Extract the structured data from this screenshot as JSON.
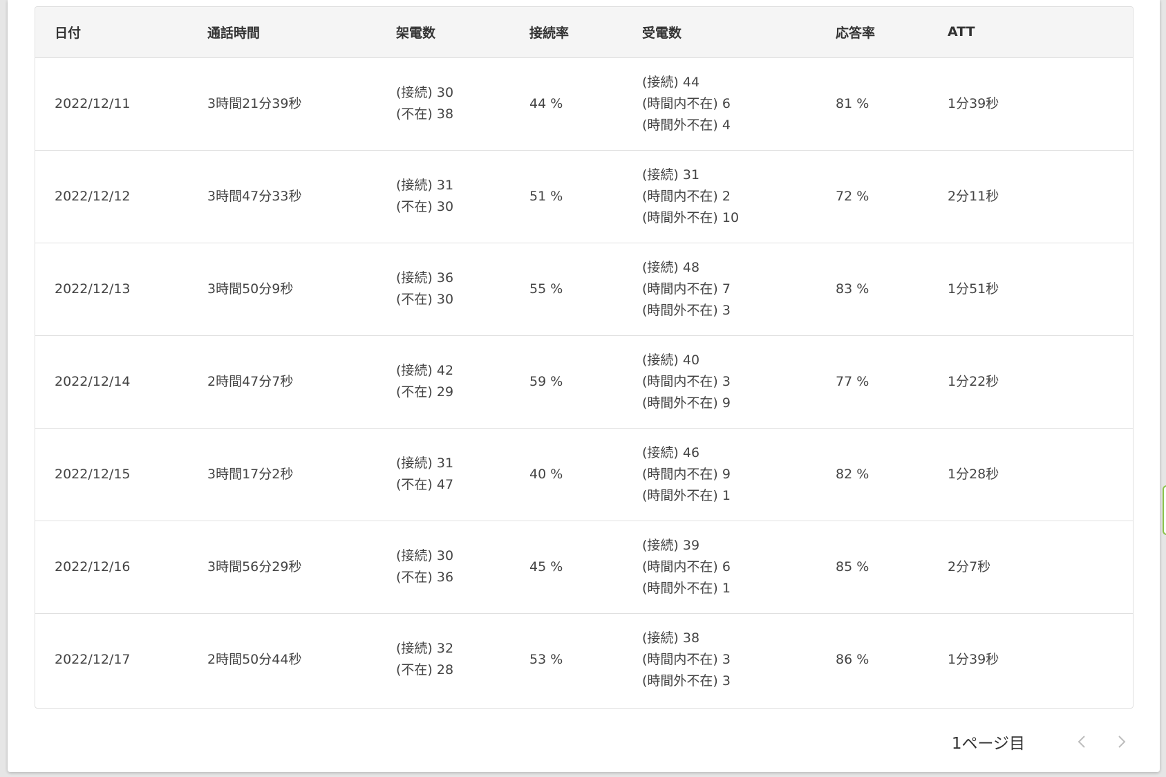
{
  "table": {
    "headers": [
      "日付",
      "通話時間",
      "架電数",
      "接続率",
      "受電数",
      "応答率",
      "ATT"
    ],
    "rows": [
      {
        "date": "2022/12/11",
        "talk_time": "3時間21分39秒",
        "outbound": [
          "(接続) 30",
          "(不在) 38"
        ],
        "connect_rate": "44 %",
        "inbound": [
          "(接続) 44",
          "(時間内不在) 6",
          "(時間外不在) 4"
        ],
        "answer_rate": "81 %",
        "att": "1分39秒"
      },
      {
        "date": "2022/12/12",
        "talk_time": "3時間47分33秒",
        "outbound": [
          "(接続) 31",
          "(不在) 30"
        ],
        "connect_rate": "51 %",
        "inbound": [
          "(接続) 31",
          "(時間内不在) 2",
          "(時間外不在) 10"
        ],
        "answer_rate": "72 %",
        "att": "2分11秒"
      },
      {
        "date": "2022/12/13",
        "talk_time": "3時間50分9秒",
        "outbound": [
          "(接続) 36",
          "(不在) 30"
        ],
        "connect_rate": "55 %",
        "inbound": [
          "(接続) 48",
          "(時間内不在) 7",
          "(時間外不在) 3"
        ],
        "answer_rate": "83 %",
        "att": "1分51秒"
      },
      {
        "date": "2022/12/14",
        "talk_time": "2時間47分7秒",
        "outbound": [
          "(接続) 42",
          "(不在) 29"
        ],
        "connect_rate": "59 %",
        "inbound": [
          "(接続) 40",
          "(時間内不在) 3",
          "(時間外不在) 9"
        ],
        "answer_rate": "77 %",
        "att": "1分22秒"
      },
      {
        "date": "2022/12/15",
        "talk_time": "3時間17分2秒",
        "outbound": [
          "(接続) 31",
          "(不在) 47"
        ],
        "connect_rate": "40 %",
        "inbound": [
          "(接続) 46",
          "(時間内不在) 9",
          "(時間外不在) 1"
        ],
        "answer_rate": "82 %",
        "att": "1分28秒"
      },
      {
        "date": "2022/12/16",
        "talk_time": "3時間56分29秒",
        "outbound": [
          "(接続) 30",
          "(不在) 36"
        ],
        "connect_rate": "45 %",
        "inbound": [
          "(接続) 39",
          "(時間内不在) 6",
          "(時間外不在) 1"
        ],
        "answer_rate": "85 %",
        "att": "2分7秒"
      },
      {
        "date": "2022/12/17",
        "talk_time": "2時間50分44秒",
        "outbound": [
          "(接続) 32",
          "(不在) 28"
        ],
        "connect_rate": "53 %",
        "inbound": [
          "(接続) 38",
          "(時間内不在) 3",
          "(時間外不在) 3"
        ],
        "answer_rate": "86 %",
        "att": "1分39秒"
      }
    ]
  },
  "pagination": {
    "page_label": "1ページ目",
    "prev_icon": "chevron-left-icon",
    "next_icon": "chevron-right-icon"
  },
  "colors": {
    "header_bg": "#f5f5f5",
    "border": "#e0e0e0",
    "accent_edge": "#8bc34a"
  }
}
